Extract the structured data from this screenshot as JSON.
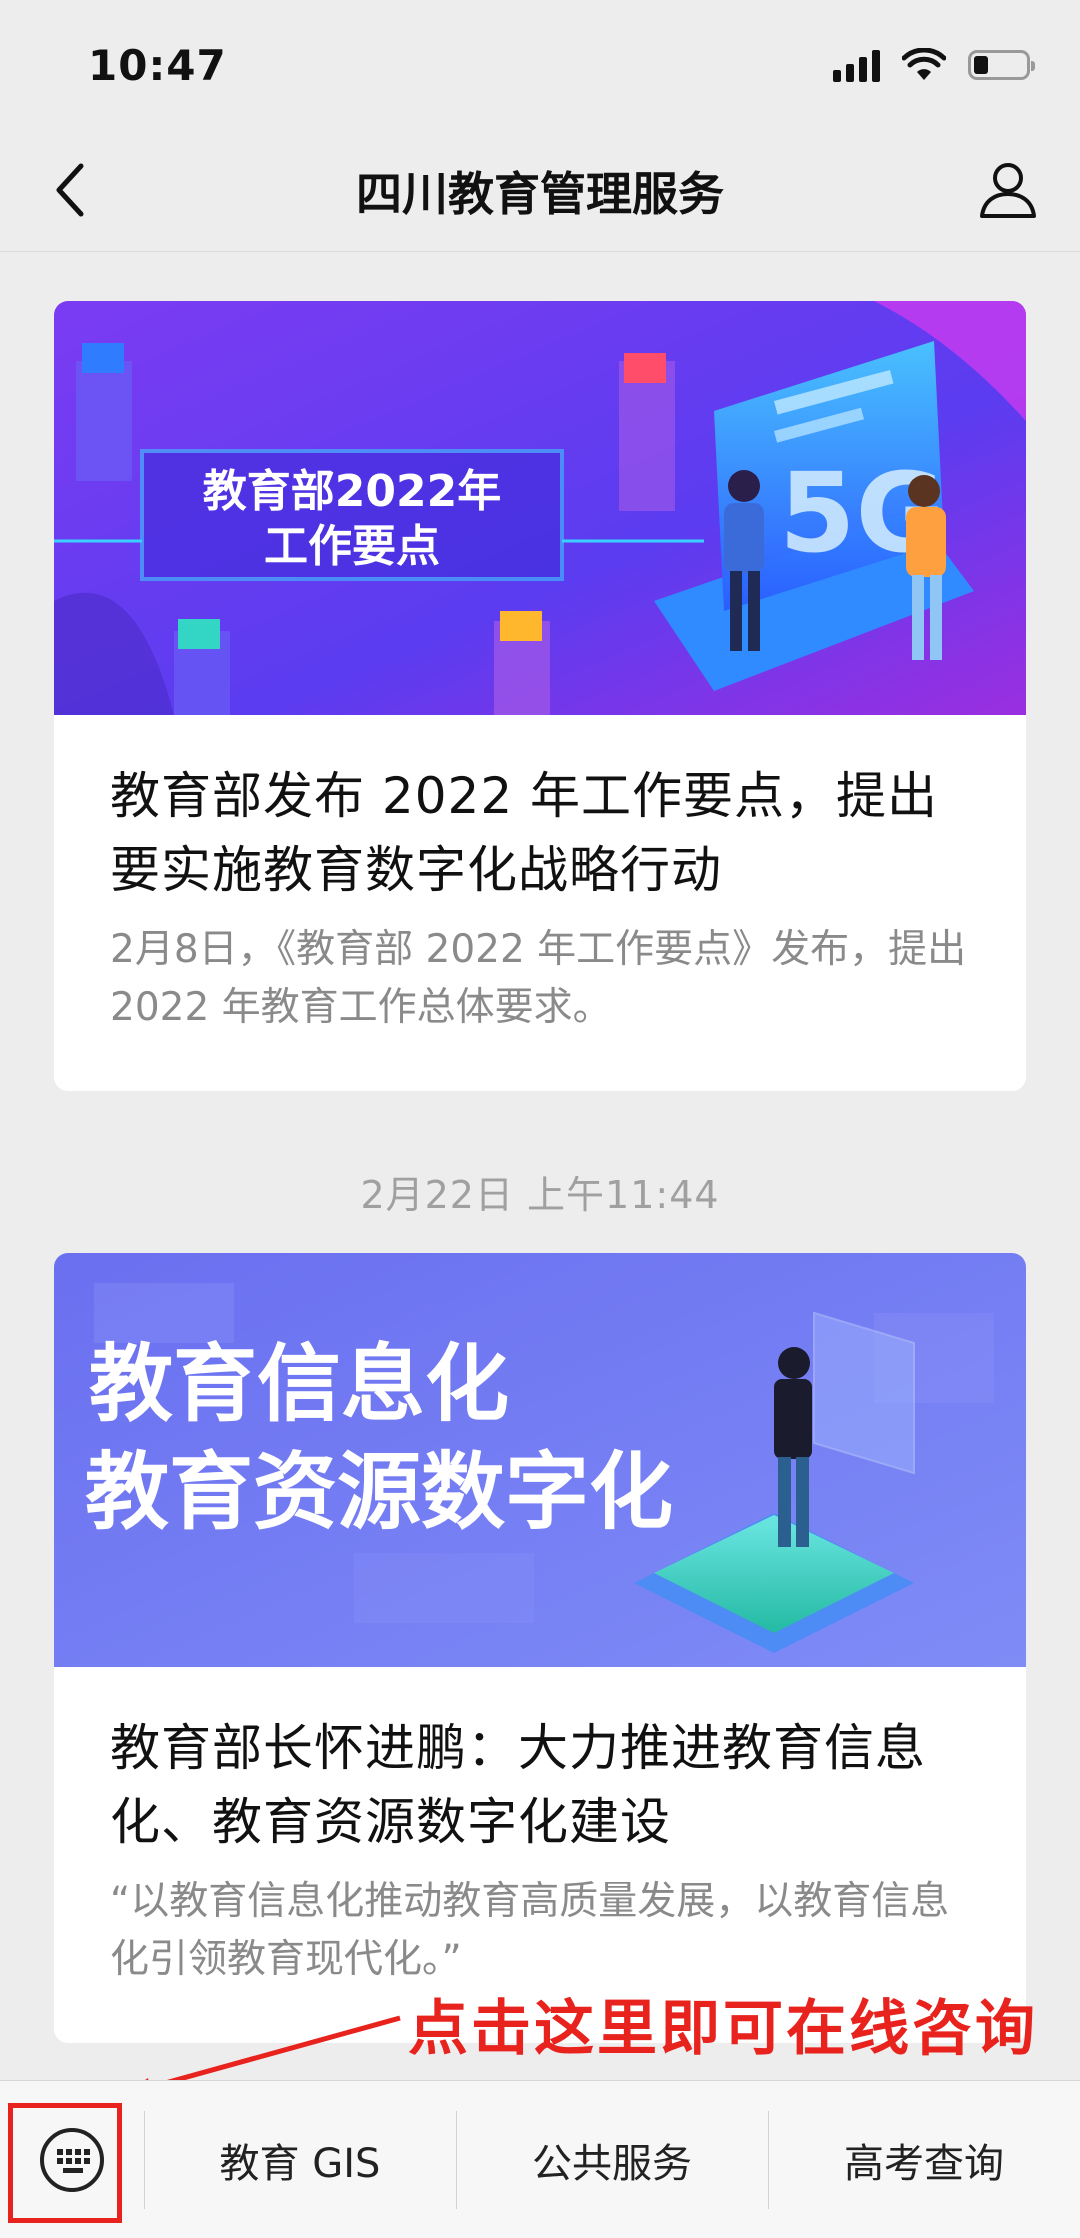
{
  "status_bar": {
    "time": "10:47"
  },
  "nav": {
    "title": "四川教育管理服务"
  },
  "articles": [
    {
      "banner_text": [
        "教育部2022年",
        "工作要点"
      ],
      "title": "教育部发布 2022 年工作要点，提出要实施教育数字化战略行动",
      "summary": "2月8日，《教育部 2022 年工作要点》发布，提出 2022 年教育工作总体要求。"
    },
    {
      "timestamp": "2月22日 上午11:44",
      "banner_text": [
        "教育信息化",
        "教育资源数字化"
      ],
      "title": "教育部长怀进鹏：大力推进教育信息化、教育资源数字化建设",
      "summary": "“以教育信息化推动教育高质量发展，以教育信息化引领教育现代化。”"
    }
  ],
  "annotation": {
    "text": "点击这里即可在线咨询"
  },
  "bottom_menu": {
    "items": [
      "教育 GIS",
      "公共服务",
      "高考查询"
    ]
  },
  "colors": {
    "background": "#ededed",
    "annotation": "#e8221d",
    "banner1": "#6a3df0",
    "banner2": "#6f79f2"
  },
  "icons": {
    "back": "chevron-left-icon",
    "profile": "person-icon",
    "keyboard": "keyboard-icon"
  }
}
